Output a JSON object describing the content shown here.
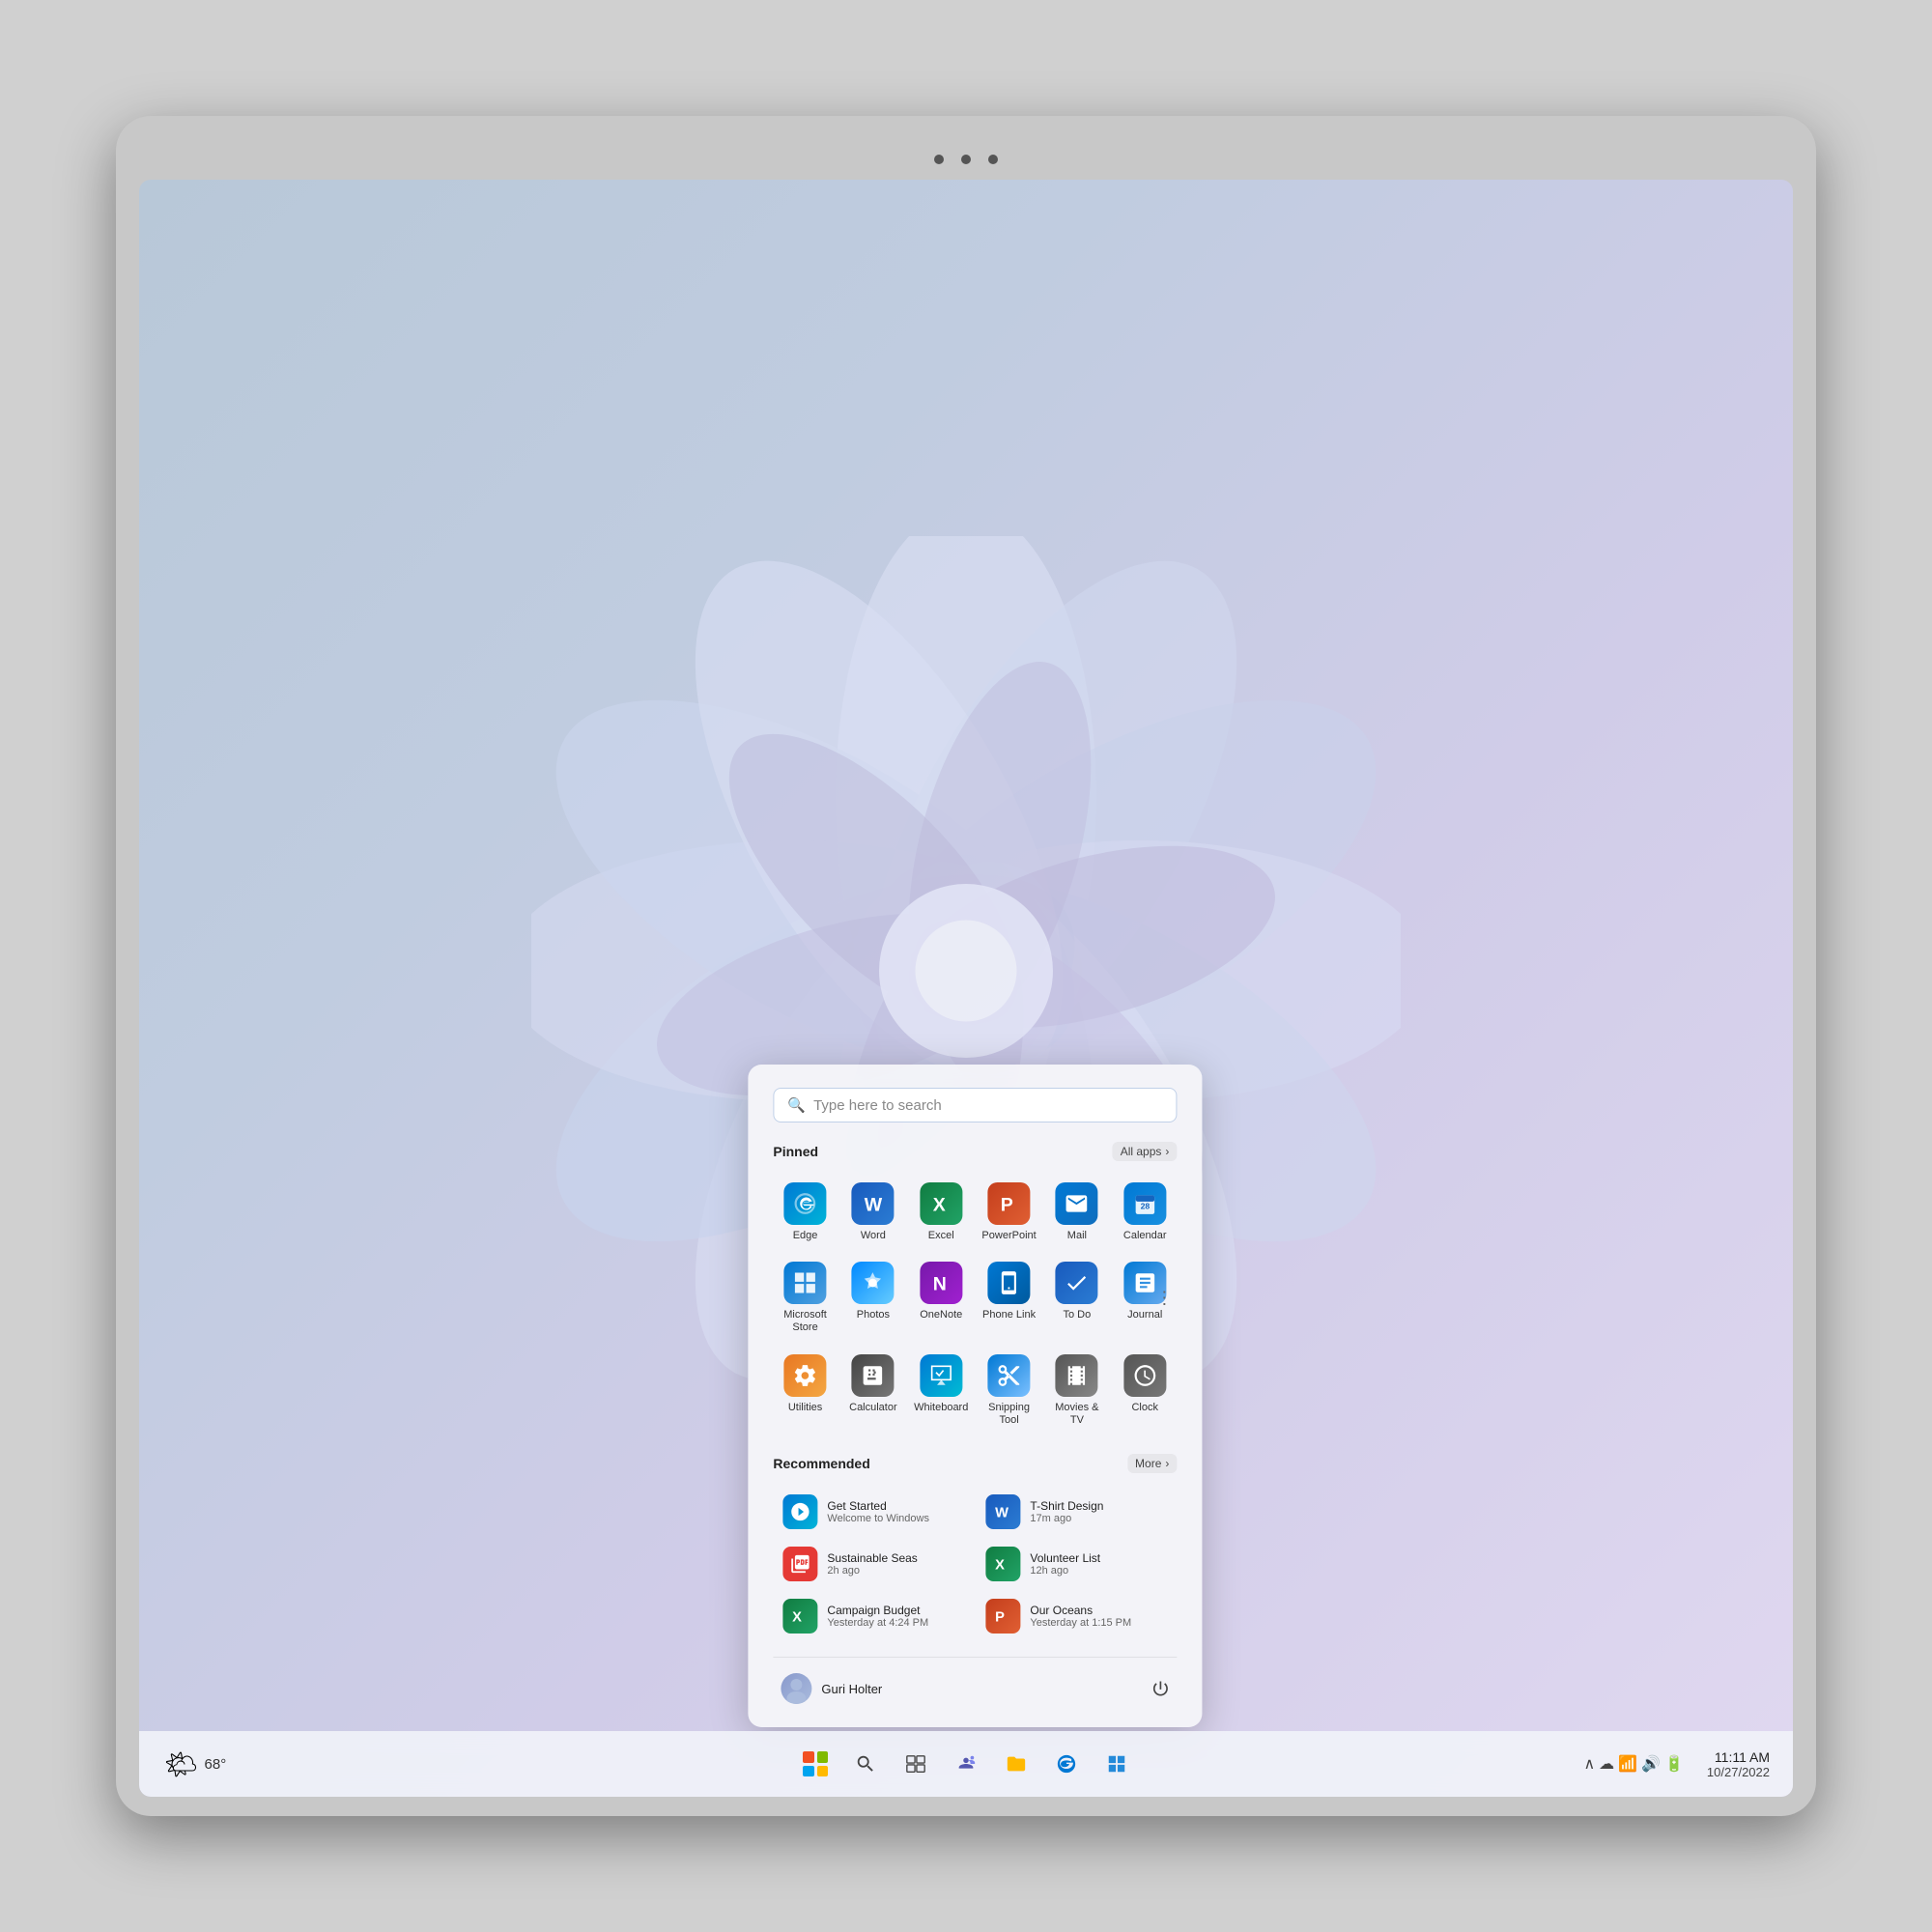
{
  "device": {
    "camera": "front-camera"
  },
  "wallpaper": {
    "alt": "Windows 11 bloom wallpaper"
  },
  "start_menu": {
    "search_placeholder": "Type here to search",
    "pinned_label": "Pinned",
    "all_apps_label": "All apps",
    "recommended_label": "Recommended",
    "more_label": "More",
    "pinned_apps": [
      {
        "id": "edge",
        "label": "Edge",
        "icon_class": "icon-edge",
        "icon": "E"
      },
      {
        "id": "word",
        "label": "Word",
        "icon_class": "icon-word",
        "icon": "W"
      },
      {
        "id": "excel",
        "label": "Excel",
        "icon_class": "icon-excel",
        "icon": "X"
      },
      {
        "id": "powerpoint",
        "label": "PowerPoint",
        "icon_class": "icon-powerpoint",
        "icon": "P"
      },
      {
        "id": "mail",
        "label": "Mail",
        "icon_class": "icon-mail",
        "icon": "✉"
      },
      {
        "id": "calendar",
        "label": "Calendar",
        "icon_class": "icon-calendar",
        "icon": "📅"
      },
      {
        "id": "msstore",
        "label": "Microsoft Store",
        "icon_class": "icon-msstore",
        "icon": "🛍"
      },
      {
        "id": "photos",
        "label": "Photos",
        "icon_class": "icon-photos",
        "icon": "🖼"
      },
      {
        "id": "onenote",
        "label": "OneNote",
        "icon_class": "icon-onenote",
        "icon": "N"
      },
      {
        "id": "phonelink",
        "label": "Phone Link",
        "icon_class": "icon-phonelink",
        "icon": "📱"
      },
      {
        "id": "todo",
        "label": "To Do",
        "icon_class": "icon-todo",
        "icon": "✓"
      },
      {
        "id": "journal",
        "label": "Journal",
        "icon_class": "icon-journal",
        "icon": "📓"
      },
      {
        "id": "utilities",
        "label": "Utilities",
        "icon_class": "icon-utilities",
        "icon": "⚙"
      },
      {
        "id": "calculator",
        "label": "Calculator",
        "icon_class": "icon-calculator",
        "icon": "="
      },
      {
        "id": "whiteboard",
        "label": "Whiteboard",
        "icon_class": "icon-whiteboard",
        "icon": "🖊"
      },
      {
        "id": "snipping",
        "label": "Snipping Tool",
        "icon_class": "icon-snipping",
        "icon": "✂"
      },
      {
        "id": "movies",
        "label": "Movies & TV",
        "icon_class": "icon-movies",
        "icon": "▶"
      },
      {
        "id": "clock",
        "label": "Clock",
        "icon_class": "icon-clock",
        "icon": "⏰"
      }
    ],
    "recommended_items": [
      {
        "id": "get-started",
        "label": "Get Started",
        "sublabel": "Welcome to Windows",
        "icon_class": "icon-edge",
        "col": 1
      },
      {
        "id": "tshirt",
        "label": "T-Shirt Design",
        "sublabel": "17m ago",
        "icon_class": "icon-word-sm",
        "col": 2
      },
      {
        "id": "seas",
        "label": "Sustainable Seas",
        "sublabel": "2h ago",
        "icon_class": "icon-pdf",
        "col": 1
      },
      {
        "id": "volunteer",
        "label": "Volunteer List",
        "sublabel": "12h ago",
        "icon_class": "icon-excel-sm",
        "col": 2
      },
      {
        "id": "campaign",
        "label": "Campaign Budget",
        "sublabel": "Yesterday at 4:24 PM",
        "icon_class": "icon-excel-sm",
        "col": 1
      },
      {
        "id": "oceans",
        "label": "Our Oceans",
        "sublabel": "Yesterday at 1:15 PM",
        "icon_class": "icon-ppt-sm",
        "col": 2
      }
    ],
    "user_name": "Guri Holter",
    "power_icon": "⏻"
  },
  "taskbar": {
    "weather_temp": "68°",
    "weather_icon": "🌤",
    "time": "11:11 AM",
    "date": "10/27/2022",
    "icons": [
      {
        "id": "start",
        "icon": "⊞",
        "label": "Start"
      },
      {
        "id": "search",
        "icon": "🔍",
        "label": "Search"
      },
      {
        "id": "task-view",
        "icon": "❏",
        "label": "Task View"
      },
      {
        "id": "teams",
        "icon": "📹",
        "label": "Teams"
      },
      {
        "id": "file-explorer",
        "icon": "📁",
        "label": "File Explorer"
      },
      {
        "id": "edge",
        "icon": "e",
        "label": "Edge"
      },
      {
        "id": "store",
        "icon": "🛍",
        "label": "Store"
      }
    ],
    "tray_icons": [
      "^",
      "☁",
      "📶",
      "🔊",
      "🔋"
    ]
  }
}
